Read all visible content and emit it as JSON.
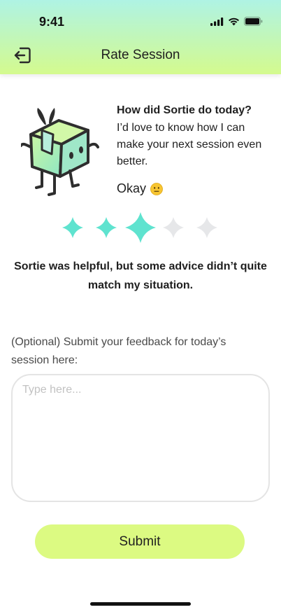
{
  "status_bar": {
    "time": "9:41"
  },
  "header": {
    "title": "Rate Session",
    "back_icon": "exit-icon"
  },
  "prompt": {
    "question": "How did Sortie do today?",
    "body": " I’d love to know how I can make your next session even better.",
    "rating_word": "Okay",
    "rating_emoji": "neutral-face-emoji"
  },
  "rating": {
    "value": 3,
    "max": 5,
    "active_color": "#5fe3cf",
    "inactive_color": "#e6e7e9",
    "description": "Sortie was helpful, but some advice didn’t quite match my situation."
  },
  "feedback": {
    "label": "(Optional) Submit your feedback for today’s session here:",
    "placeholder": "Type here...",
    "value": ""
  },
  "submit": {
    "label": "Submit",
    "color": "#dcfa82"
  },
  "theme": {
    "header_gradient_top": "#aff3e4",
    "header_gradient_bottom": "#d4fa8e"
  }
}
